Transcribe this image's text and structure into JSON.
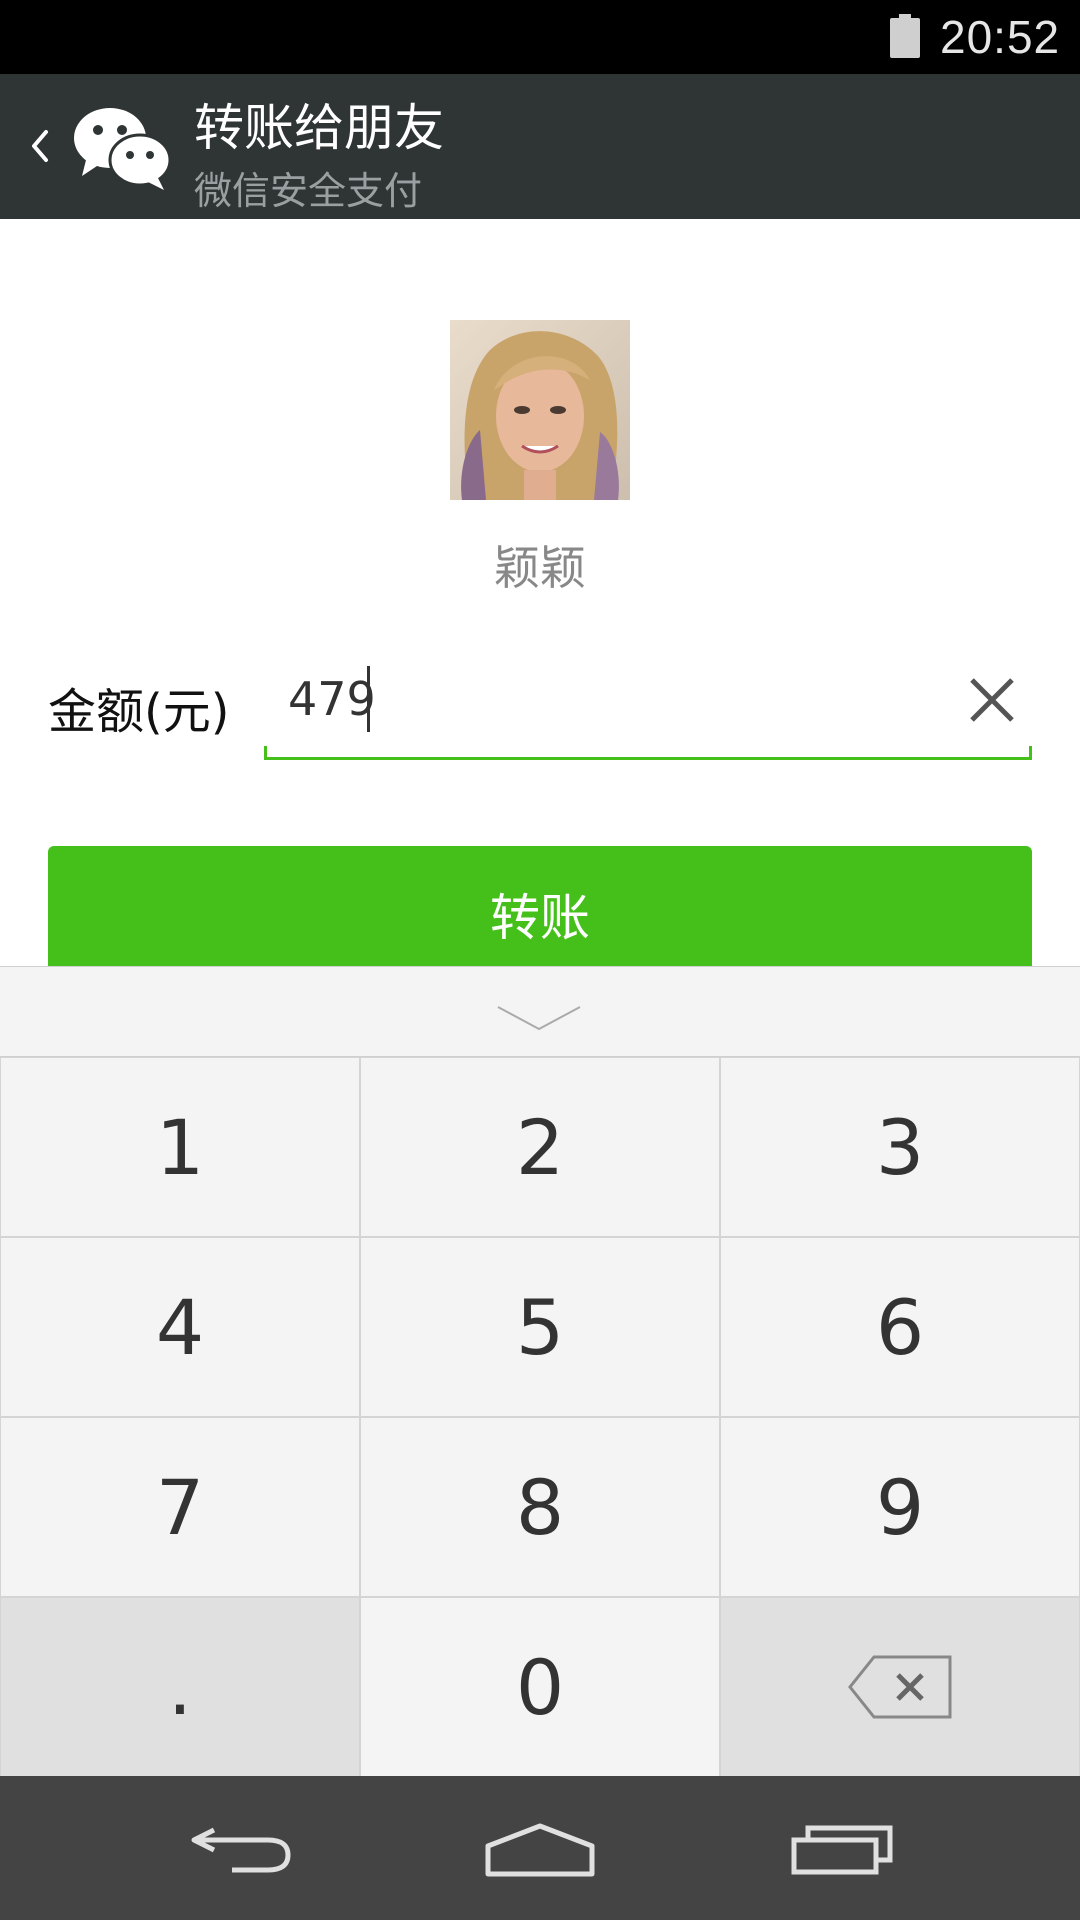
{
  "status_bar": {
    "time": "20:52",
    "battery_icon": "battery-full-icon"
  },
  "header": {
    "title": "转账给朋友",
    "subtitle": "微信安全支付",
    "back_icon": "chevron-left-icon",
    "app_icon": "wechat-logo-icon"
  },
  "recipient": {
    "name": "颖颖"
  },
  "amount": {
    "label": "金额(元)",
    "value": "479",
    "clear_icon": "close-icon"
  },
  "transfer_button": {
    "label": "转账"
  },
  "keyboard": {
    "collapse_icon": "chevron-down-icon",
    "keys": [
      "1",
      "2",
      "3",
      "4",
      "5",
      "6",
      "7",
      "8",
      "9",
      ".",
      "0"
    ],
    "delete_icon": "backspace-icon"
  },
  "nav_bar": {
    "back_icon": "nav-back-icon",
    "home_icon": "nav-home-icon",
    "recents_icon": "nav-recents-icon"
  },
  "colors": {
    "accent": "#45c01a",
    "header_bg": "#2f3435",
    "nav_bg": "#444444"
  }
}
